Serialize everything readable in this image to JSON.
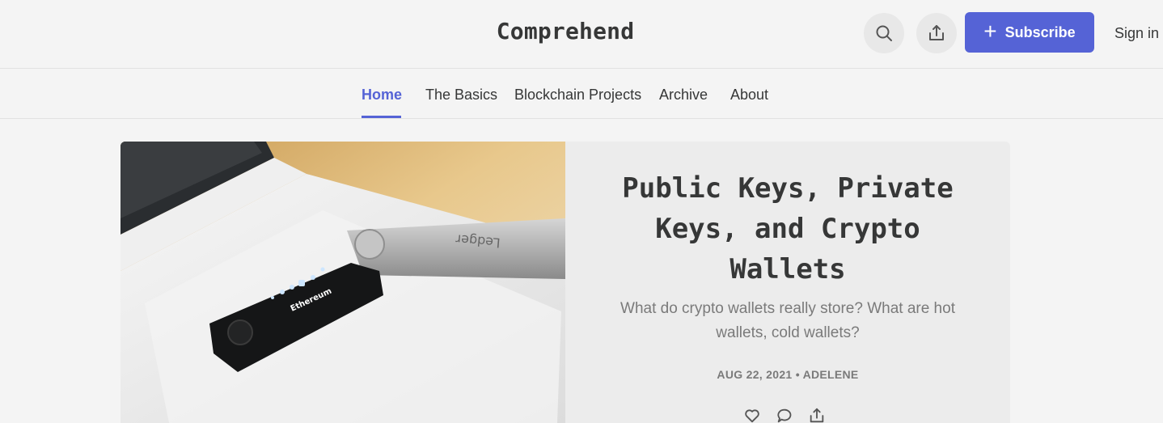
{
  "header": {
    "site_title": "Comprehend",
    "search_icon": "search-icon",
    "share_icon": "share-icon",
    "subscribe_label": "Subscribe",
    "subscribe_icon": "plus-icon",
    "signin_label": "Sign in",
    "accent_color": "#5563d6"
  },
  "nav": {
    "items": [
      {
        "label": "Home",
        "active": true
      },
      {
        "label": "The Basics"
      },
      {
        "label": "Blockchain Projects"
      },
      {
        "label": "Archive"
      },
      {
        "label": "About"
      }
    ]
  },
  "post": {
    "title": "Public Keys, Private Keys, and Crypto Wallets",
    "subtitle": "What do crypto wallets really store? What are hot wallets, cold wallets?",
    "meta": "AUG 22, 2021 • ADELENE",
    "device_label": "Ethereum",
    "device_brand": "Ledger",
    "actions": [
      "heart-icon",
      "comment-icon",
      "share-icon"
    ]
  }
}
